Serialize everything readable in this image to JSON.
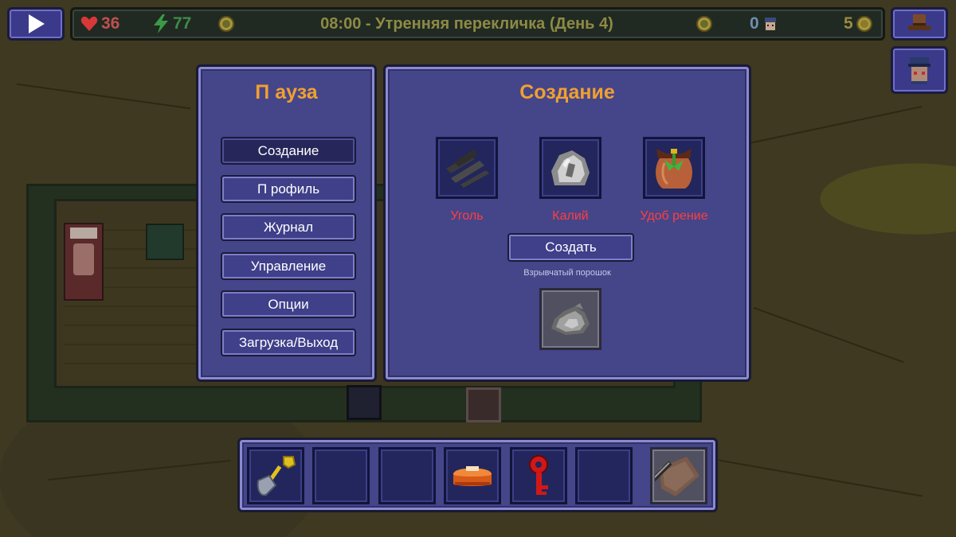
{
  "hud": {
    "health": "36",
    "energy": "77",
    "title": "08:00 - Утренняя перекличка (День 4)",
    "heat": "0",
    "money": "5",
    "colors": {
      "health": "#e05050",
      "energy": "#4aa050",
      "title": "#8e8a45",
      "money": "#9a8a40",
      "heat": "#8aa0c0"
    }
  },
  "buttons": {
    "play_icon": "play-icon",
    "outfit_icon": "hat-icon",
    "character_icon": "guard-portrait-icon"
  },
  "pause_menu": {
    "title": "П ауза",
    "items": [
      {
        "label": "Создание",
        "active": true
      },
      {
        "label": "П рофиль",
        "active": false
      },
      {
        "label": "Журнал",
        "active": false
      },
      {
        "label": "Управление",
        "active": false
      },
      {
        "label": "Опции",
        "active": false
      },
      {
        "label": "Загрузка/Выход",
        "active": false
      }
    ]
  },
  "crafting": {
    "title": "Создание",
    "ingredients": [
      {
        "name": "Уголь",
        "icon": "coal-icon"
      },
      {
        "name": "Калий",
        "icon": "potassium-icon"
      },
      {
        "name": "Удоб рение",
        "icon": "fertilizer-icon"
      }
    ],
    "create_label": "Создать",
    "result_name": "Взрывчатый порошок",
    "result_icon": "explosive-powder-icon"
  },
  "inventory": {
    "slots": [
      {
        "icon": "shovel-icon"
      },
      {
        "icon": ""
      },
      {
        "icon": ""
      },
      {
        "icon": "cake-icon"
      },
      {
        "icon": "red-key-icon"
      },
      {
        "icon": ""
      },
      {
        "icon": "crowbar-icon",
        "equipped": true
      }
    ]
  }
}
